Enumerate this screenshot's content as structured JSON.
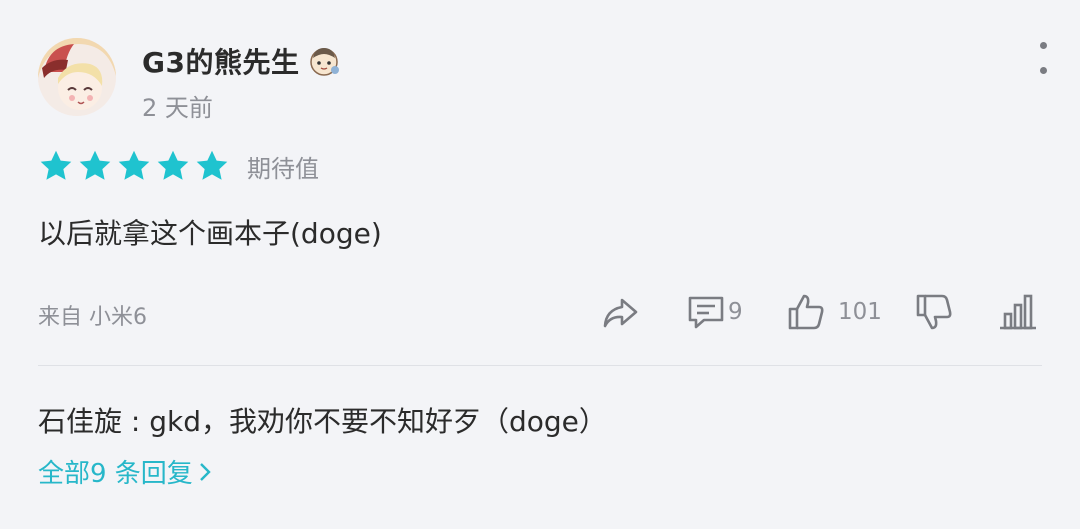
{
  "user": {
    "name": "G3的熊先生",
    "time": "2 天前",
    "avatar_icon": "anime-avatar-icon",
    "badge_icon": "cartoon-badge-icon"
  },
  "rating": {
    "stars": 5,
    "max": 5,
    "label": "期待值",
    "color": "#1fc3cf"
  },
  "comment": {
    "text": "以后就拿这个画本子(doge)"
  },
  "footer": {
    "device": "来自 小米6",
    "actions": {
      "share_icon": "share-icon",
      "reply_icon": "comment-icon",
      "reply_count": "9",
      "like_icon": "thumbs-up-icon",
      "like_count": "101",
      "dislike_icon": "thumbs-down-icon",
      "stats_icon": "bar-chart-icon"
    }
  },
  "replies": {
    "first": "石佳旋 : gkd，我劝你不要不知好歹（doge）",
    "view_all": "全部9 条回复",
    "accent": "#27b7c9"
  }
}
